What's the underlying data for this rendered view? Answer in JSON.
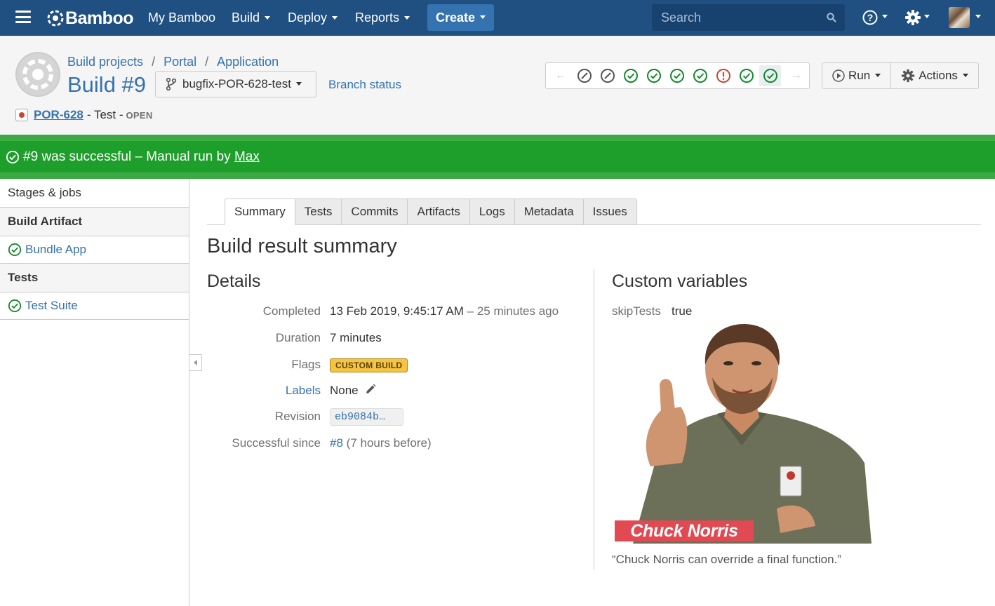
{
  "topnav": {
    "brand": "Bamboo",
    "items": [
      {
        "label": "My Bamboo",
        "dropdown": false
      },
      {
        "label": "Build",
        "dropdown": true
      },
      {
        "label": "Deploy",
        "dropdown": true
      },
      {
        "label": "Reports",
        "dropdown": true
      }
    ],
    "create_label": "Create",
    "search_placeholder": "Search",
    "colors": {
      "bar": "#205081",
      "create": "#3572b0",
      "search": "#174270"
    }
  },
  "breadcrumbs": [
    "Build projects",
    "Portal",
    "Application"
  ],
  "build": {
    "title": "Build #9",
    "branch": "bugfix-POR-628-test",
    "branch_status_link": "Branch status",
    "jira_key": "POR-628",
    "jira_summary": "- Test -",
    "jira_status": "OPEN"
  },
  "history": {
    "icons": [
      "arrow-left-icon",
      "disabled-icon",
      "disabled-icon",
      "success-icon",
      "success-icon",
      "success-icon",
      "success-icon",
      "failed-icon",
      "success-icon",
      "success-icon",
      "arrow-right-icon"
    ],
    "current_index": 9
  },
  "actions": {
    "run_label": "Run",
    "actions_label": "Actions"
  },
  "banner": {
    "text": "#9 was successful – Manual run by",
    "user": "Max",
    "color": "#1e9e2b"
  },
  "sidebar": {
    "stages_label": "Stages & jobs",
    "groups": [
      {
        "heading": "Build Artifact",
        "jobs": [
          "Bundle App"
        ]
      },
      {
        "heading": "Tests",
        "jobs": [
          "Test Suite"
        ]
      }
    ]
  },
  "tabs": [
    "Summary",
    "Tests",
    "Commits",
    "Artifacts",
    "Logs",
    "Metadata",
    "Issues"
  ],
  "summary": {
    "heading": "Build result summary",
    "details_heading": "Details",
    "completed_label": "Completed",
    "completed_value": "13 Feb 2019, 9:45:17 AM",
    "completed_relative": "– 25 minutes ago",
    "duration_label": "Duration",
    "duration_value": "7 minutes",
    "flags_label": "Flags",
    "flags_value": "CUSTOM BUILD",
    "labels_label": "Labels",
    "labels_value": "None",
    "revision_label": "Revision",
    "revision_value": "eb9084b…",
    "since_label": "Successful since",
    "since_build": "#8",
    "since_relative": "(7 hours before)"
  },
  "custom_variables": {
    "heading": "Custom variables",
    "items": [
      {
        "key": "skipTests",
        "value": "true"
      }
    ],
    "image_caption": "Chuck Norris",
    "quote": "“Chuck Norris can override a final function.”"
  }
}
